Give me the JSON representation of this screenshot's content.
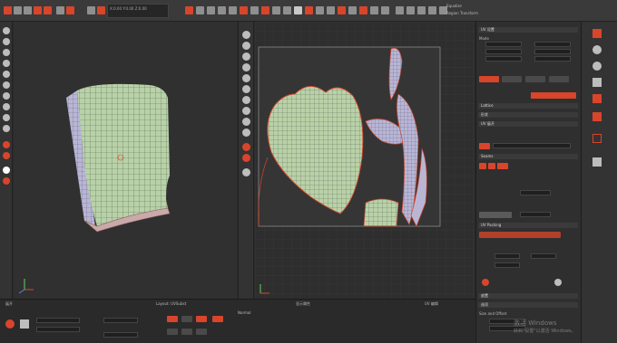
{
  "toolbar": {
    "transform_left": "",
    "transform_right": "",
    "coords": "X:0.00 Y:0.00 Z:0.00"
  },
  "right_panel": {
    "title": "Equalize",
    "tab_label": "Region Transform",
    "sections": [
      "UV 设置",
      "Lattice",
      "形状",
      "UV 展开",
      "Seams",
      "UV Packing",
      "放置"
    ],
    "buttons": [
      "展开",
      "打包",
      "重置"
    ],
    "field_labels": [
      "Mode",
      "Iter",
      "Count",
      "Margin",
      "Size",
      "Rotation"
    ],
    "values": [
      "0",
      "0.5",
      "2",
      "64",
      "0.01",
      "90"
    ]
  },
  "bottom": {
    "header1": "展开",
    "header2": "Layout: UVSubst",
    "header3": "显示属性",
    "header4": "UV 编辑",
    "header5": "选项",
    "mode_text": "Normal",
    "size_label": "Size and Offset"
  },
  "watermark": {
    "line1": "激活 Windows",
    "line2": "转到\"设置\"以激活 Windows。"
  }
}
